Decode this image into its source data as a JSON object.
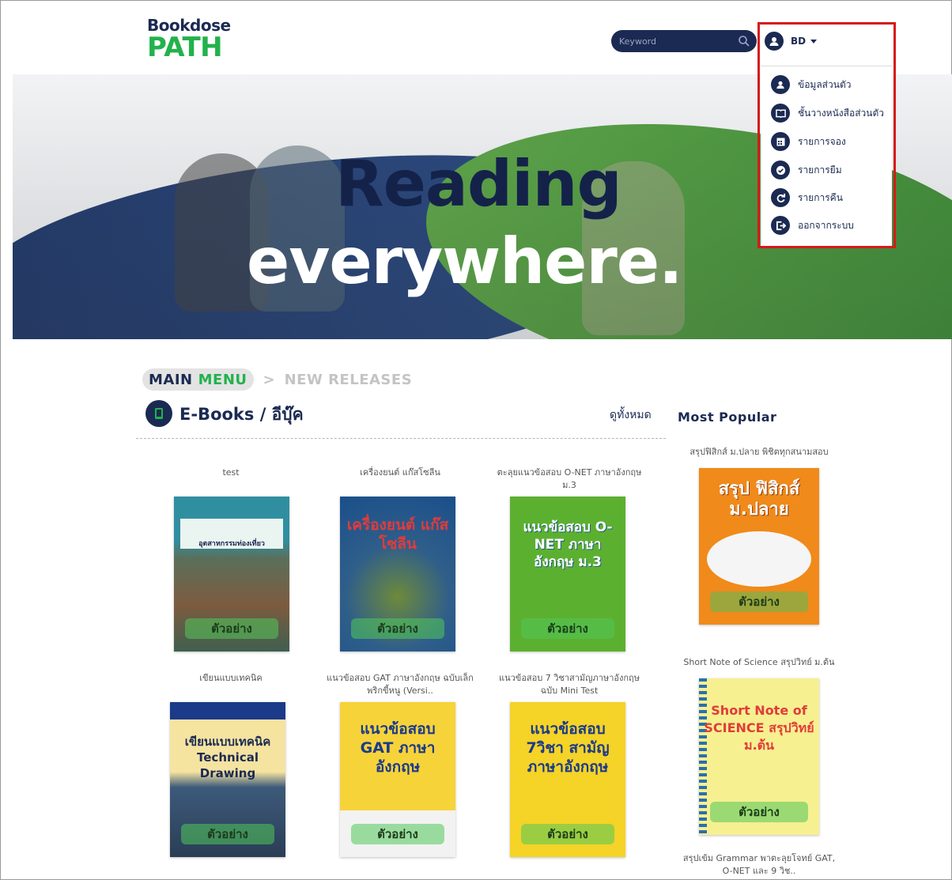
{
  "header": {
    "logo_top": "Bookdose",
    "logo_bottom": "PATH",
    "search_placeholder": "Keyword",
    "user_name": "BD"
  },
  "hero": {
    "line1": "Reading",
    "line2": "everywhere."
  },
  "user_menu": {
    "items": [
      {
        "label": "ข้อมูลส่วนตัว",
        "icon": "user-icon"
      },
      {
        "label": "ชั้นวางหนังสือส่วนตัว",
        "icon": "book-open-icon"
      },
      {
        "label": "รายการจอง",
        "icon": "calendar-icon"
      },
      {
        "label": "รายการยืม",
        "icon": "check-circle-icon"
      },
      {
        "label": "รายการคืน",
        "icon": "refresh-icon"
      },
      {
        "label": "ออกจากระบบ",
        "icon": "logout-icon"
      }
    ]
  },
  "breadcrumb": {
    "main": "MAIN",
    "menu": "MENU",
    "separator": ">",
    "current": "NEW RELEASES"
  },
  "section": {
    "title": "E-Books / อีบุ๊ค",
    "see_all": "ดูทั้งหมด"
  },
  "popular": {
    "title": "Most Popular",
    "books": [
      {
        "title": "สรุปฟิสิกส์ ม.ปลาย พิชิตทุกสนามสอบ",
        "cover_text": "สรุป ฟิสิกส์ ม.ปลาย",
        "sample": "ตัวอย่าง"
      },
      {
        "title": "Short Note of Science สรุปวิทย์ ม.ต้น",
        "cover_text": "Short Note of SCIENCE สรุปวิทย์ ม.ต้น",
        "sample": "ตัวอย่าง"
      },
      {
        "title": "สรุปเข้ม Grammar พาตะลุยโจทย์ GAT, O-NET และ 9 วิช.."
      }
    ]
  },
  "books": [
    {
      "title": "test",
      "cover_text": "อุตสาหกรรมท่องเที่ยว",
      "sample": "ตัวอย่าง"
    },
    {
      "title": "เครื่องยนต์ แก๊สโซลีน",
      "cover_text": "เครื่องยนต์ แก๊สโซลีน",
      "sample": "ตัวอย่าง"
    },
    {
      "title": "ตะลุยแนวข้อสอบ O-NET ภาษาอังกฤษ ม.3",
      "cover_text": "แนวข้อสอบ O-NET ภาษาอังกฤษ ม.3",
      "sample": "ตัวอย่าง"
    },
    {
      "title": "เขียนแบบเทคนิค",
      "cover_text": "เขียนแบบเทคนิค Technical Drawing",
      "sample": "ตัวอย่าง"
    },
    {
      "title": "แนวข้อสอบ GAT ภาษาอังกฤษ ฉบับเล็กพริกขี้หนู (Versi..",
      "cover_text": "แนวข้อสอบ GAT ภาษาอังกฤษ",
      "sample": "ตัวอย่าง"
    },
    {
      "title": "แนวข้อสอบ 7 วิชาสามัญภาษาอังกฤษ ฉบับ Mini Test",
      "cover_text": "แนวข้อสอบ 7วิชา สามัญ ภาษาอังกฤษ",
      "sample": "ตัวอย่าง"
    }
  ],
  "colors": {
    "navy": "#1b2a52",
    "green": "#22b24c",
    "highlight_border": "#d61a1a"
  }
}
